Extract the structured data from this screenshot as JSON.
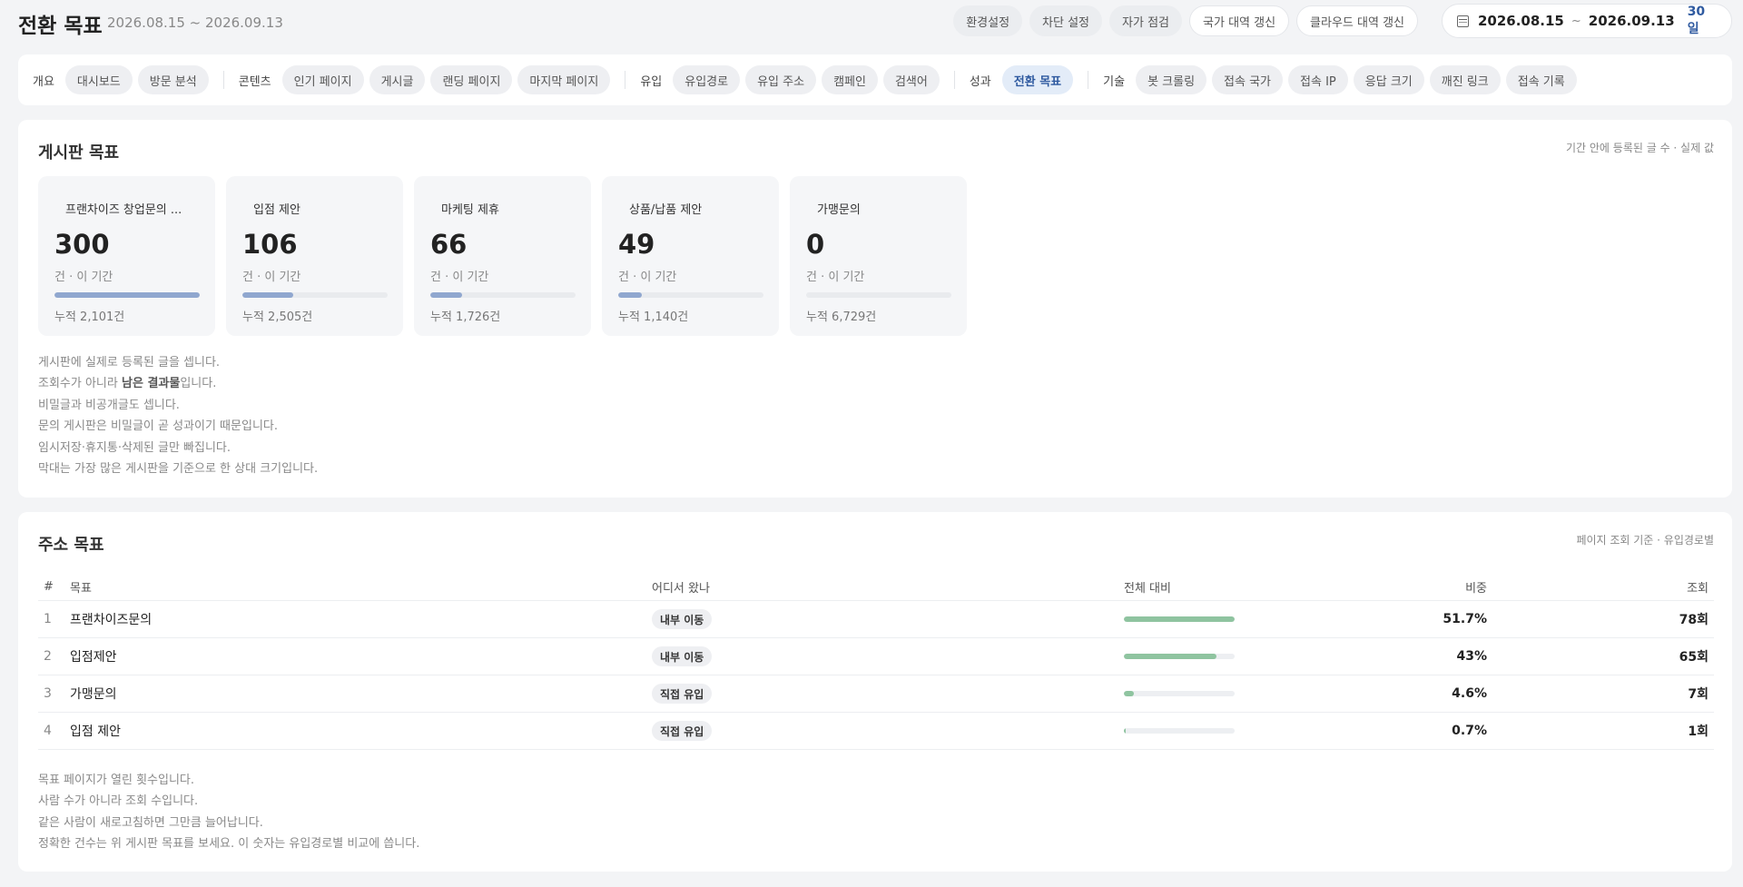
{
  "header": {
    "title": "전환 목표",
    "date_range": "2026.08.15 ~ 2026.09.13",
    "actions": [
      {
        "label": "환경설정",
        "style": "gray"
      },
      {
        "label": "차단 설정",
        "style": "gray"
      },
      {
        "label": "자가 점검",
        "style": "gray"
      },
      {
        "label": "국가 대역 갱신",
        "style": "white"
      },
      {
        "label": "클라우드 대역 갱신",
        "style": "white"
      }
    ],
    "date_picker": {
      "from": "2026.08.15",
      "tilde": "~",
      "to": "2026.09.13",
      "days": "30일"
    }
  },
  "nav": {
    "groups": [
      {
        "label": "개요",
        "items": [
          "대시보드",
          "방문 분석"
        ]
      },
      {
        "label": "콘텐츠",
        "items": [
          "인기 페이지",
          "게시글",
          "랜딩 페이지",
          "마지막 페이지"
        ]
      },
      {
        "label": "유입",
        "items": [
          "유입경로",
          "유입 주소",
          "캠페인",
          "검색어"
        ]
      },
      {
        "label": "성과",
        "items": [
          "전환 목표"
        ]
      },
      {
        "label": "기술",
        "items": [
          "봇 크롤링",
          "접속 국가",
          "접속 IP",
          "응답 크기",
          "깨진 링크",
          "접속 기록"
        ]
      }
    ],
    "active": "전환 목표"
  },
  "board_goals": {
    "title": "게시판 목표",
    "note": "기간 안에 등록된 글 수 · 실제 값",
    "cards": [
      {
        "name": "프랜차이즈 창업문의 ...",
        "value": "300",
        "unit": "건 · 이 기간",
        "bar_fraction": 1.0,
        "total": "누적 2,101건"
      },
      {
        "name": "입점 제안",
        "value": "106",
        "unit": "건 · 이 기간",
        "bar_fraction": 0.353,
        "total": "누적 2,505건"
      },
      {
        "name": "마케팅 제휴",
        "value": "66",
        "unit": "건 · 이 기간",
        "bar_fraction": 0.22,
        "total": "누적 1,726건"
      },
      {
        "name": "상품/납품 제안",
        "value": "49",
        "unit": "건 · 이 기간",
        "bar_fraction": 0.163,
        "total": "누적 1,140건"
      },
      {
        "name": "가맹문의",
        "value": "0",
        "unit": "건 · 이 기간",
        "bar_fraction": 0.0,
        "total": "누적 6,729건"
      }
    ],
    "notes": {
      "line1": "게시판에 실제로 등록된 글을 셉니다.",
      "line2_pre": "조회수가 아니라 ",
      "line2_bold": "남은 결과물",
      "line2_post": "입니다.",
      "line3": "비밀글과 비공개글도 셉니다.",
      "line4": "문의 게시판은 비밀글이 곧 성과이기 때문입니다.",
      "line5": "임시저장·휴지통·삭제된 글만 빠집니다.",
      "line6": "막대는 가장 많은 게시판을 기준으로 한 상대 크기입니다."
    }
  },
  "url_goals": {
    "title": "주소 목표",
    "note": "페이지 조회 기준 · 유입경로별",
    "columns": {
      "num": "#",
      "goal": "목표",
      "source": "어디서 왔나",
      "compare": "전체 대비",
      "share": "비중",
      "views": "조회"
    },
    "rows": [
      {
        "num": "1",
        "goal": "프랜차이즈문의",
        "source": "내부 이동",
        "fraction": 1.0,
        "share": "51.7%",
        "views": "78회"
      },
      {
        "num": "2",
        "goal": "입점제안",
        "source": "내부 이동",
        "fraction": 0.833,
        "share": "43%",
        "views": "65회"
      },
      {
        "num": "3",
        "goal": "가맹문의",
        "source": "직접 유입",
        "fraction": 0.09,
        "share": "4.6%",
        "views": "7회"
      },
      {
        "num": "4",
        "goal": "입점 제안",
        "source": "직접 유입",
        "fraction": 0.013,
        "share": "0.7%",
        "views": "1회"
      }
    ],
    "notes": [
      "목표 페이지가 열린 횟수입니다.",
      "사람 수가 아니라 조회 수입니다.",
      "같은 사람이 새로고침하면 그만큼 늘어납니다.",
      "정확한 건수는 위 게시판 목표를 보세요. 이 숫자는 유입경로별 비교에 씁니다."
    ]
  }
}
